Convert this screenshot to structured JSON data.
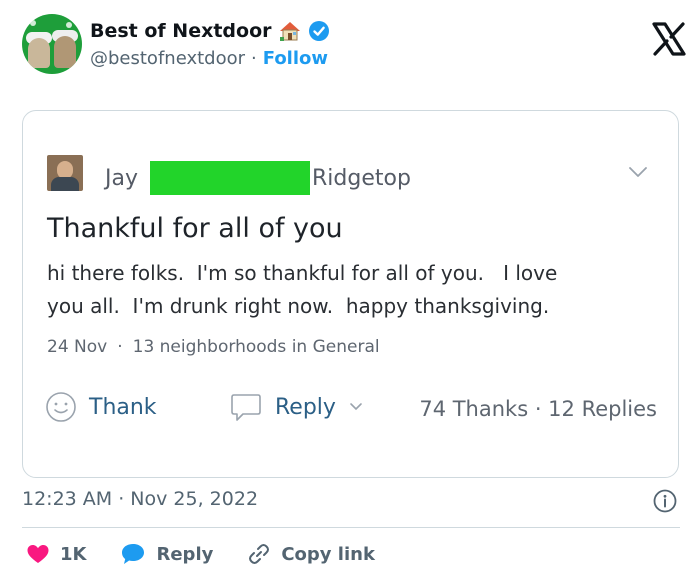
{
  "tweet": {
    "account_name": "Best of Nextdoor",
    "handle": "@bestofnextdoor",
    "separator": "·",
    "follow_label": "Follow",
    "timestamp": "12:23 AM · Nov 25, 2022",
    "likes_count": "1K",
    "reply_label": "Reply",
    "copy_link_label": "Copy link",
    "icons": [
      "house-icon",
      "verified-icon",
      "x-logo-icon",
      "info-icon",
      "heart-icon",
      "reply-bubble-icon",
      "link-icon"
    ],
    "colors": {
      "link_blue": "#1d9bf0",
      "heart_red": "#f91880",
      "text_gray": "#536471"
    }
  },
  "post": {
    "author_first": "Jay",
    "author_last_partial": "Ridgetop",
    "title": "Thankful for all of you",
    "body_line1": "hi there folks.  I'm so thankful for all of you.   I love",
    "body_line2": "you all.  I'm drunk right now.  happy thanksgiving.",
    "date": "24 Nov",
    "meta_sep": "·",
    "audience": "13 neighborhoods in General",
    "thank_label": "Thank",
    "reply_label": "Reply",
    "stats": "74 Thanks · 12 Replies",
    "redaction_color": "#22d42a"
  }
}
